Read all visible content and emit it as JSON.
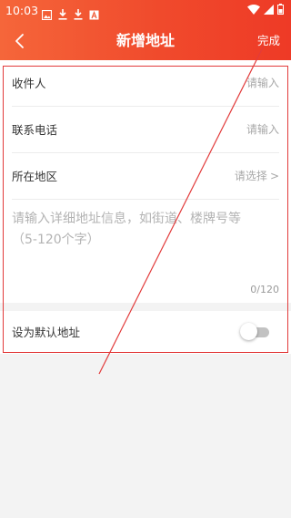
{
  "status_bar": {
    "time": "10:03",
    "left_icons": [
      "image-icon",
      "download-icon",
      "download-icon",
      "a-box-icon"
    ],
    "right_icons": [
      "wifi-icon",
      "signal-icon",
      "battery-icon"
    ]
  },
  "header": {
    "title": "新增地址",
    "done_label": "完成",
    "back_icon": "chevron-left-icon",
    "gradient_colors": [
      "#f5663a",
      "#ee3a26"
    ]
  },
  "form": {
    "recipient": {
      "label": "收件人",
      "placeholder": "请输入"
    },
    "phone": {
      "label": "联系电话",
      "placeholder": "请输入"
    },
    "region": {
      "label": "所在地区",
      "placeholder": "请选择",
      "chevron": ">"
    },
    "detail": {
      "placeholder_line1": "请输入详细地址信息，如街道、楼牌号等",
      "placeholder_line2": "（5-120个字）",
      "count": "0/120"
    },
    "default": {
      "label": "设为默认地址",
      "enabled": false
    }
  },
  "colors": {
    "accent": "#f04a2c",
    "annotation": "#e23b3b",
    "text": "#333333",
    "placeholder": "#a8a8a8"
  }
}
